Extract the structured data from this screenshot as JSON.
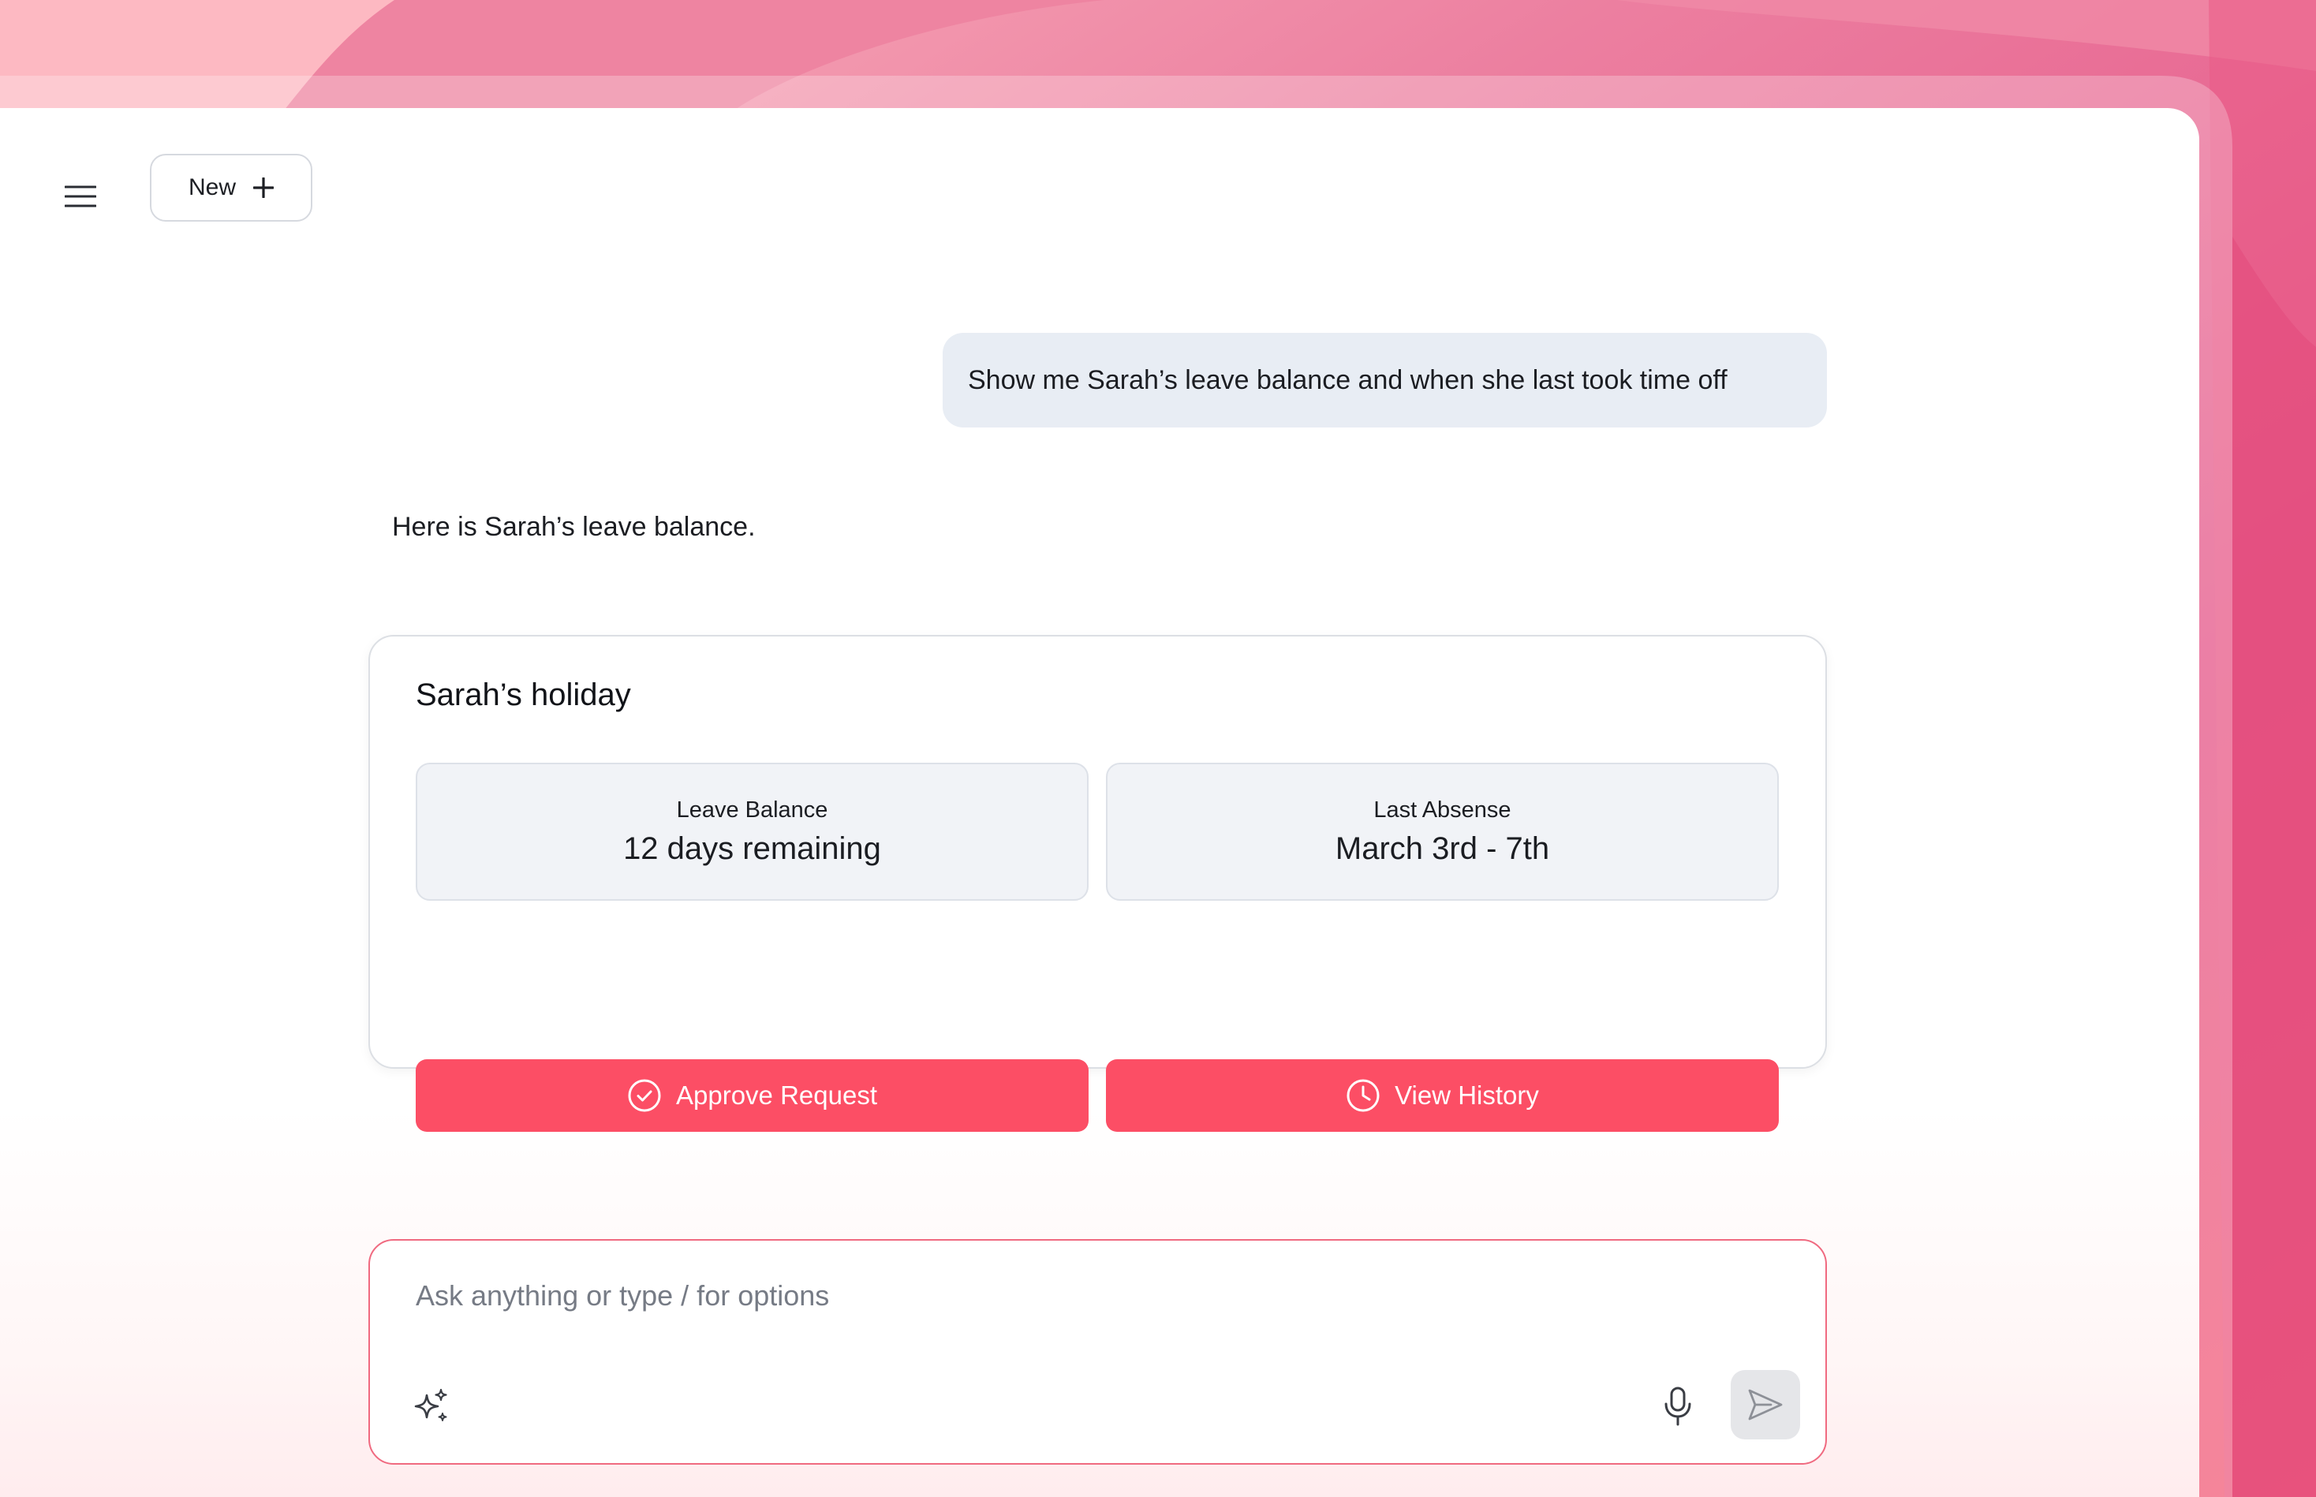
{
  "header": {
    "menu_icon": "hamburger-menu-icon",
    "new_button": {
      "label": "New",
      "icon": "plus-icon"
    }
  },
  "conversation": {
    "user_message": "Show me Sarah’s leave balance and when she last took time off",
    "assistant_message": "Here is Sarah’s leave balance."
  },
  "holiday_card": {
    "title": "Sarah’s holiday",
    "stats": [
      {
        "label": "Leave Balance",
        "value": "12 days remaining"
      },
      {
        "label": "Last Absense",
        "value": "March 3rd - 7th"
      }
    ],
    "actions": [
      {
        "label": "Approve Request",
        "icon": "check-circle-icon"
      },
      {
        "label": "View History",
        "icon": "clock-icon"
      }
    ]
  },
  "composer": {
    "placeholder": "Ask anything or type / for options",
    "value": "",
    "icons": [
      "sparkle-icon",
      "microphone-icon",
      "send-icon"
    ]
  },
  "colors": {
    "accent": "#fc4e65",
    "composer_border": "#f06a80",
    "background_pink": "#e85a8a",
    "bubble_bg": "#e8edf4",
    "stat_bg": "#f1f3f7"
  }
}
